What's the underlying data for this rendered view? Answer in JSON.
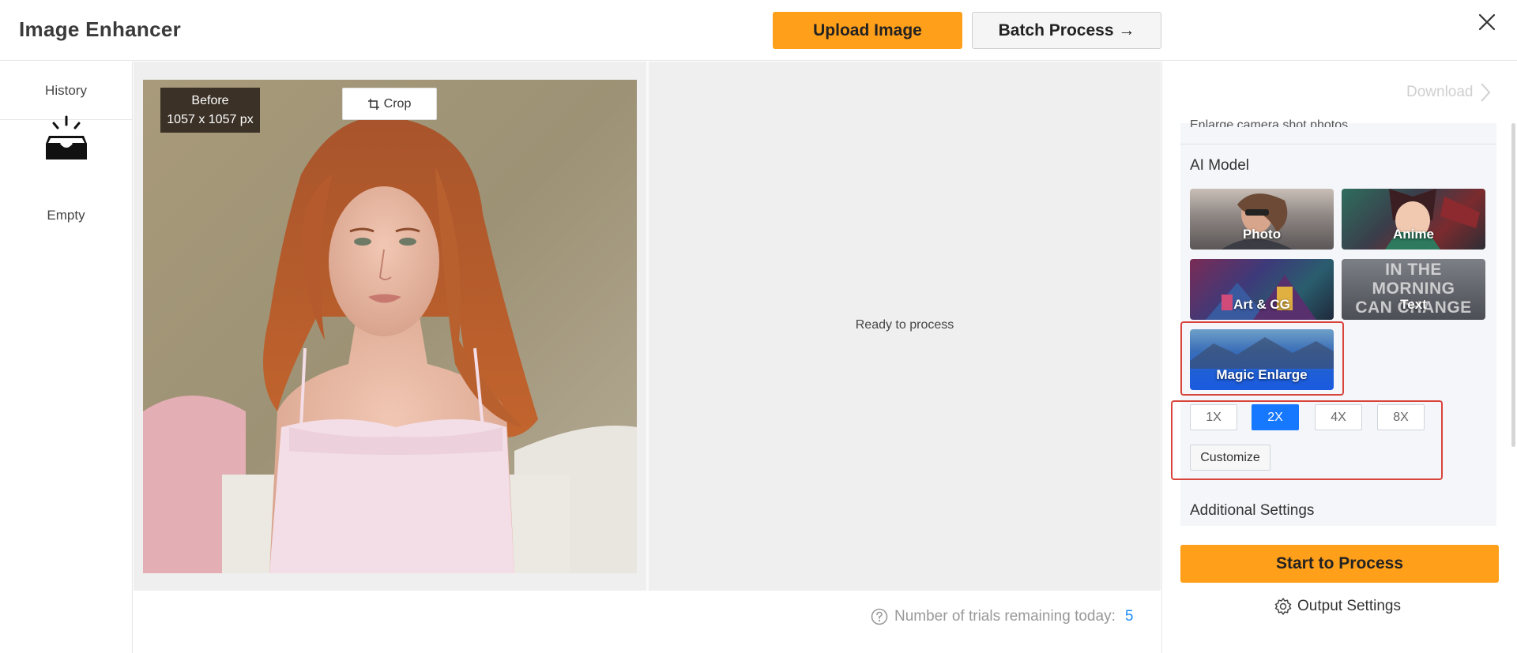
{
  "header": {
    "title": "Image Enhancer",
    "upload_label": "Upload Image",
    "batch_label": "Batch Process →"
  },
  "sidebar": {
    "history_label": "History",
    "empty_label": "Empty"
  },
  "preview": {
    "before_label": "Before",
    "dimensions": "1057 x 1057 px",
    "crop_label": "Crop",
    "ready_text": "Ready to process"
  },
  "trials": {
    "label": "Number of trials remaining today:",
    "count": "5"
  },
  "panel": {
    "download_label": "Download",
    "cut_text": "Enlarge camera shot photos.",
    "ai_model_label": "AI Model",
    "models": [
      {
        "label": "Photo"
      },
      {
        "label": "Anime"
      },
      {
        "label": "Art & CG"
      },
      {
        "label": "Text"
      },
      {
        "label": "Magic Enlarge",
        "selected": true
      }
    ],
    "text_card_overlay": [
      "IN THE MORNING",
      "CAN CHANGE YOUR"
    ],
    "scales": [
      "1X",
      "2X",
      "4X",
      "8X"
    ],
    "selected_scale": "2X",
    "customize_label": "Customize",
    "additional_label": "Additional Settings",
    "start_label": "Start to Process",
    "output_settings_label": "Output Settings"
  },
  "colors": {
    "accent_orange": "#ff9f1a",
    "accent_blue": "#1677ff",
    "highlight_red": "#d9443a"
  }
}
